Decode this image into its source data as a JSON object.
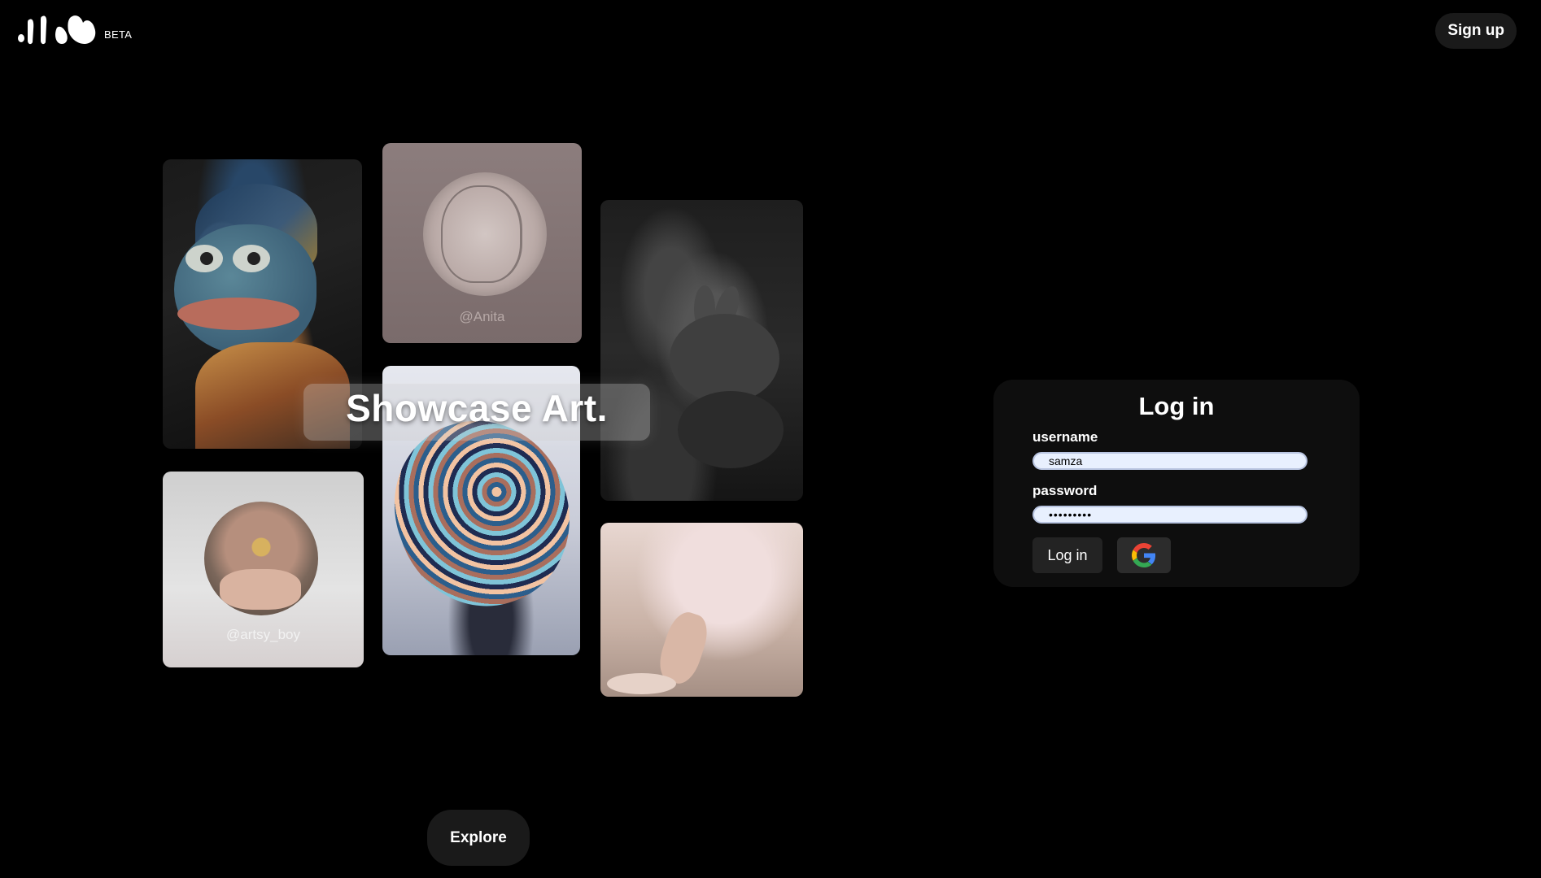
{
  "header": {
    "beta_label": "BETA",
    "signup_label": "Sign up"
  },
  "gallery": {
    "headline": "Showcase Art.",
    "cards": [
      {
        "kind": "painting-frog"
      },
      {
        "kind": "profile",
        "handle": "@Anita"
      },
      {
        "kind": "swirl-sculpture"
      },
      {
        "kind": "photo-rabbits"
      },
      {
        "kind": "profile",
        "handle": "@artsy_boy"
      },
      {
        "kind": "painting-ballet"
      }
    ]
  },
  "explore_label": "Explore",
  "login": {
    "title": "Log in",
    "username_label": "username",
    "username_value": "samza",
    "password_label": "password",
    "password_value": "•••••••••",
    "login_button": "Log in",
    "google_icon": "google-icon"
  },
  "colors": {
    "background": "#000000",
    "panel": "#0e0e0e",
    "input_bg": "#e8f0fe"
  }
}
